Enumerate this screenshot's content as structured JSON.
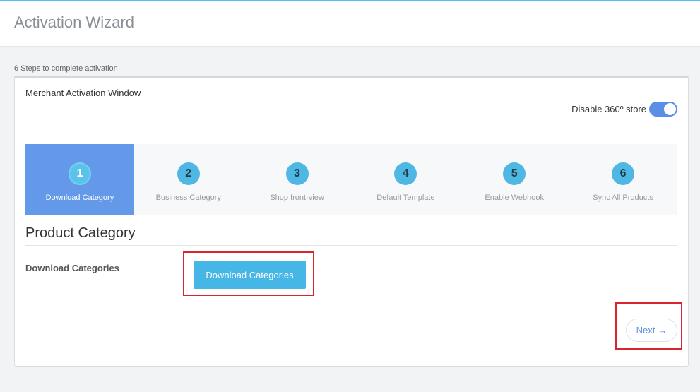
{
  "header": {
    "title": "Activation Wizard"
  },
  "steps_note": "6 Steps to complete activation",
  "card": {
    "title": "Merchant Activation Window",
    "toggle": {
      "label": "Disable 360º store",
      "on": true
    }
  },
  "steps": [
    {
      "num": "1",
      "label": "Download Category",
      "active": true
    },
    {
      "num": "2",
      "label": "Business Category",
      "active": false
    },
    {
      "num": "3",
      "label": "Shop front-view",
      "active": false
    },
    {
      "num": "4",
      "label": "Default Template",
      "active": false
    },
    {
      "num": "5",
      "label": "Enable Webhook",
      "active": false
    },
    {
      "num": "6",
      "label": "Sync All Products",
      "active": false
    }
  ],
  "section": {
    "title": "Product Category",
    "field_label": "Download Categories",
    "button_label": "Download Categories"
  },
  "footer": {
    "next_label": "Next",
    "next_arrow": "→"
  },
  "colors": {
    "accent": "#4fc3f7",
    "active_step": "#6399e8",
    "step_circle": "#4fb7e3",
    "primary_button": "#45b6e6",
    "highlight": "#d9232d"
  }
}
